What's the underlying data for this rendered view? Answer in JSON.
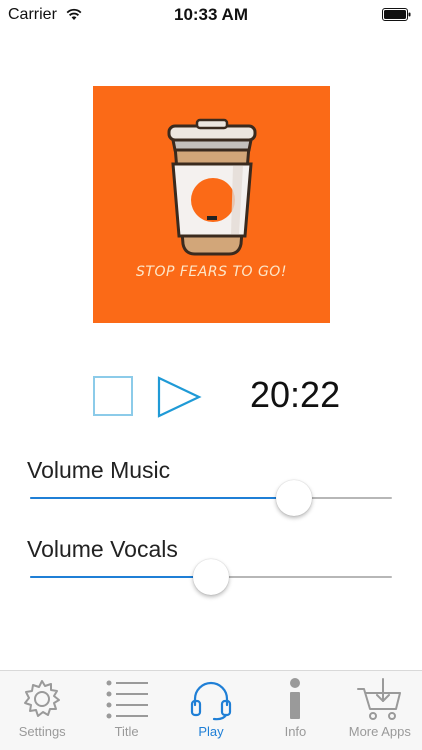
{
  "status_bar": {
    "carrier": "Carrier",
    "time": "10:33 AM"
  },
  "album": {
    "caption": "STOP FEARS TO GO!",
    "background_color": "#fb6a17"
  },
  "player": {
    "elapsed": "20:22",
    "control_color": "#1f9ad6",
    "stop_icon": "stop-icon",
    "play_icon": "play-icon"
  },
  "sliders": [
    {
      "label": "Volume Music",
      "value": 0.73
    },
    {
      "label": "Volume Vocals",
      "value": 0.5
    }
  ],
  "colors": {
    "accent": "#1f7fd6",
    "inactive": "#9a9a9a"
  },
  "tabs": [
    {
      "label": "Settings",
      "icon": "gear-icon",
      "active": false
    },
    {
      "label": "Title",
      "icon": "list-icon",
      "active": false
    },
    {
      "label": "Play",
      "icon": "headphones-icon",
      "active": true
    },
    {
      "label": "Info",
      "icon": "info-icon",
      "active": false
    },
    {
      "label": "More Apps",
      "icon": "cart-icon",
      "active": false
    }
  ]
}
